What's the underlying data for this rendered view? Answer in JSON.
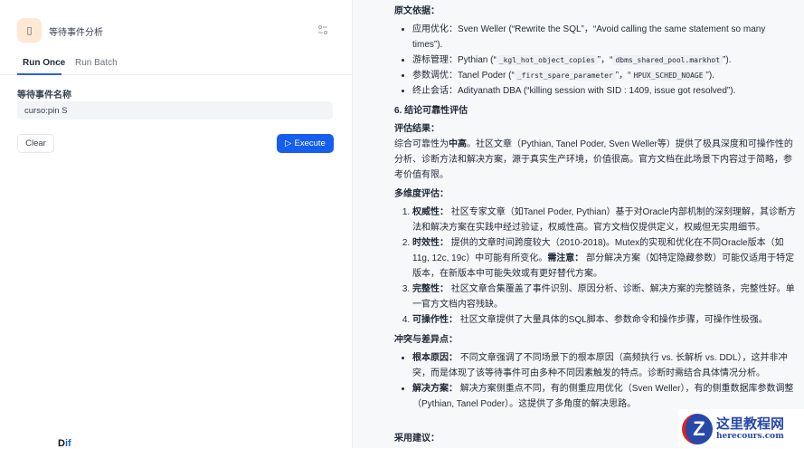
{
  "app": {
    "icon": "document-icon",
    "title": "等待事件分析"
  },
  "tabs": [
    {
      "label": "Run Once",
      "active": true
    },
    {
      "label": "Run Batch",
      "active": false
    }
  ],
  "form": {
    "field_label": "等待事件名称",
    "field_value": "curso:pin S"
  },
  "buttons": {
    "clear": "Clear",
    "execute": "Execute"
  },
  "brand": {
    "prefix": "D",
    "suffix": "if"
  },
  "colors": {
    "accent": "#155eef",
    "icon_bg": "#fde8d4"
  },
  "output": {
    "source_heading": "原文依据：",
    "sources": [
      {
        "label": "应用优化：",
        "text": "Sven Weller (“Rewrite the SQL”，“Avoid calling the same statement so many times”)."
      },
      {
        "label": "游标管理：",
        "pre": "Pythian (“",
        "code1": "_kgl_hot_object_copies",
        "mid": "”，“",
        "code2": "dbms_shared_pool.markhot",
        "post": "”)."
      },
      {
        "label": "参数调优：",
        "pre": "Tanel Poder (“",
        "code1": "_first_spare_parameter",
        "mid": "”，“",
        "code2": "HPUX_SCHED_NOAGE",
        "post": "”)."
      },
      {
        "label": "终止会话：",
        "text": "Adityanath DBA (“killing session with SID : 1409, issue got resolved”)."
      }
    ],
    "section6": "6. 结论可靠性评估",
    "result_heading": "评估结果：",
    "result_pre": "综合可靠性为",
    "result_bold": "中高",
    "result_post": "。社区文章（Pythian, Tanel Poder, Sven Weller等）提供了极具深度和可操作性的分析、诊断方法和解决方案，源于真实生产环境，价值很高。官方文档在此场景下内容过于简略，参考价值有限。",
    "multi_heading": "多维度评估：",
    "multi": [
      {
        "label": "权威性：",
        "text": " 社区专家文章（如Tanel Poder, Pythian）基于对Oracle内部机制的深刻理解，其诊断方法和解决方案在实践中经过验证，权威性高。官方文档仅提供定义，权威但无实用细节。"
      },
      {
        "label": "时效性：",
        "text": " 提供的文章时间跨度较大（2010-2018)。Mutex的实现和优化在不同Oracle版本（如11g, 12c, 19c）中可能有所变化。",
        "label2": "需注意：",
        "text2": " 部分解决方案（如特定隐藏参数）可能仅适用于特定版本，在新版本中可能失效或有更好替代方案。"
      },
      {
        "label": "完整性：",
        "text": " 社区文章合集覆盖了事件识别、原因分析、诊断、解决方案的完整链条，完整性好。单一官方文档内容残缺。"
      },
      {
        "label": "可操作性：",
        "text": " 社区文章提供了大量具体的SQL脚本、参数命令和操作步骤，可操作性极强。"
      }
    ],
    "conflict_heading": "冲突与差异点：",
    "conflicts": [
      {
        "label": "根本原因：",
        "text": " 不同文章强调了不同场景下的根本原因（高频执行 vs. 长解析 vs. DDL），这并非冲突，而是体现了该等待事件可由多种不同因素触发的特点。诊断时需结合具体情况分析。"
      },
      {
        "label": "解决方案：",
        "text": " 解决方案侧重点不同，有的侧重应用优化（Sven Weller），有的侧重数据库参数调整（Pythian, Tanel Poder）。这提供了多角度的解决思路。"
      }
    ],
    "adopt_heading": "采用建议："
  },
  "watermark": {
    "title": "这里教程网",
    "url": "herecours.com"
  }
}
